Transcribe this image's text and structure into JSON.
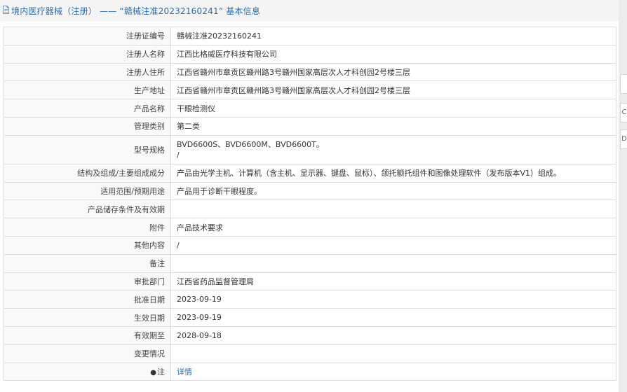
{
  "header": {
    "title": "境内医疗器械（注册） —— “赣械注准20232160241” 基本信息"
  },
  "side_tabs": [
    "",
    "C",
    "D"
  ],
  "rows": [
    {
      "label": "注册证编号",
      "value": "赣械注准20232160241"
    },
    {
      "label": "注册人名称",
      "value": "江西比格威医疗科技有限公司"
    },
    {
      "label": "注册人住所",
      "value": "江西省赣州市章贡区赣州路3号赣州国家高层次人才科创园2号楼三层"
    },
    {
      "label": "生产地址",
      "value": "江西省赣州市章贡区赣州路3号赣州国家高层次人才科创园2号楼三层"
    },
    {
      "label": "产品名称",
      "value": "干眼检测仪"
    },
    {
      "label": "管理类别",
      "value": "第二类"
    },
    {
      "label": "型号规格",
      "value": "BVD6600S、BVD6600M、BVD6600T。",
      "value2": "/"
    },
    {
      "label": "结构及组成/主要组成成分",
      "value": "产品由光学主机、计算机（含主机、显示器、键盘、鼠标）、颌托额托组件和图像处理软件（发布版本V1）组成。"
    },
    {
      "label": "适用范围/预期用途",
      "value": "产品用于诊断干眼程度。"
    },
    {
      "label": "产品储存条件及有效期",
      "value": ""
    },
    {
      "label": "附件",
      "value": "产品技术要求"
    },
    {
      "label": "其他内容",
      "value": "/"
    },
    {
      "label": "备注",
      "value": ""
    },
    {
      "label": "审批部门",
      "value": "江西省药品监督管理局"
    },
    {
      "label": "批准日期",
      "value": "2023-09-19"
    },
    {
      "label": "生效日期",
      "value": "2023-09-19"
    },
    {
      "label": "有效期至",
      "value": "2028-09-18"
    },
    {
      "label": "变更情况",
      "value": ""
    },
    {
      "label": "注",
      "value": "详情"
    }
  ]
}
